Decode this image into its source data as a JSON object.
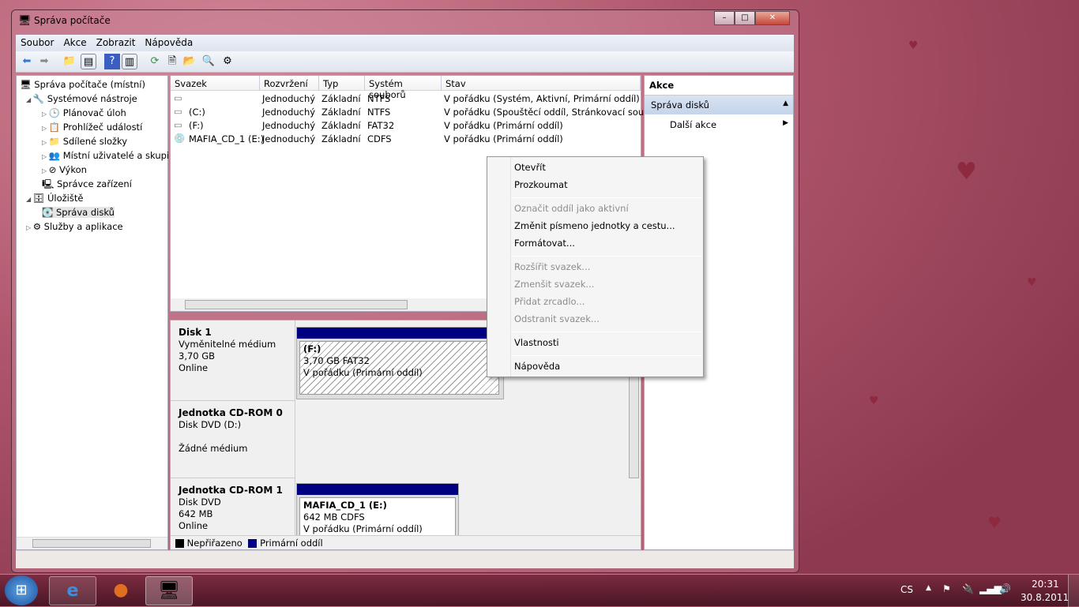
{
  "window": {
    "title": "Správa počítače",
    "buttons": [
      "–",
      "□",
      "✕"
    ]
  },
  "menu": [
    "Soubor",
    "Akce",
    "Zobrazit",
    "Nápověda"
  ],
  "tree": {
    "root": "Správa počítače (místní)",
    "items": [
      {
        "label": "Systémové nástroje",
        "level": 1
      },
      {
        "label": "Plánovač úloh",
        "level": 2
      },
      {
        "label": "Prohlížeč událostí",
        "level": 2
      },
      {
        "label": "Sdílené složky",
        "level": 2
      },
      {
        "label": "Místní uživatelé a skupiny",
        "level": 2
      },
      {
        "label": "Výkon",
        "level": 2
      },
      {
        "label": "Správce zařízení",
        "level": 2
      },
      {
        "label": "Úložiště",
        "level": 1
      },
      {
        "label": "Správa disků",
        "level": 2
      },
      {
        "label": "Služby a aplikace",
        "level": 1
      }
    ]
  },
  "volumes": {
    "columns": [
      "Svazek",
      "Rozvržení",
      "Typ",
      "Systém souborů",
      "Stav"
    ],
    "rows": [
      [
        "",
        "Jednoduchý",
        "Základní",
        "NTFS",
        "V pořádku (Systém, Aktivní, Primární oddíl)"
      ],
      [
        "(C:)",
        "Jednoduchý",
        "Základní",
        "NTFS",
        "V pořádku (Spouštěcí oddíl, Stránkovací soubo"
      ],
      [
        "(F:)",
        "Jednoduchý",
        "Základní",
        "FAT32",
        "V pořádku (Primární oddíl)"
      ],
      [
        "MAFIA_CD_1 (E:)",
        "Jednoduchý",
        "Základní",
        "CDFS",
        "V pořádku (Primární oddíl)"
      ]
    ]
  },
  "disks": [
    {
      "name": "Disk 1",
      "lines": [
        "Vyměnitelné médium",
        "3,70 GB",
        "Online"
      ],
      "partition": {
        "name": "(F:)",
        "size": "3,70 GB FAT32",
        "status": "V pořádku (Primární oddíl)"
      }
    },
    {
      "name": "Jednotka CD-ROM 0",
      "lines": [
        "Disk DVD (D:)",
        "",
        "Žádné médium"
      ]
    },
    {
      "name": "Jednotka CD-ROM 1",
      "lines": [
        "Disk DVD",
        "642 MB",
        "Online"
      ],
      "partition": {
        "name": "MAFIA_CD_1  (E:)",
        "size": "642 MB CDFS",
        "status": "V pořádku (Primární oddíl)"
      }
    }
  ],
  "legend": [
    "Nepřiřazeno",
    "Primární oddíl"
  ],
  "actions": {
    "header": "Akce",
    "section": "Správa disků",
    "more": "Další akce"
  },
  "context_menu": [
    {
      "label": "Otevřít",
      "enabled": true
    },
    {
      "label": "Prozkoumat",
      "enabled": true
    },
    {
      "label": "Označit oddíl jako aktivní",
      "enabled": false
    },
    {
      "label": "Změnit písmeno jednotky a cestu...",
      "enabled": true
    },
    {
      "label": "Formátovat...",
      "enabled": true
    },
    {
      "label": "Rozšířit svazek...",
      "enabled": false
    },
    {
      "label": "Zmenšit svazek...",
      "enabled": false
    },
    {
      "label": "Přidat zrcadlo...",
      "enabled": false
    },
    {
      "label": "Odstranit svazek...",
      "enabled": false
    },
    {
      "label": "Vlastnosti",
      "enabled": true
    },
    {
      "label": "Nápověda",
      "enabled": true
    }
  ],
  "tray": {
    "lang": "CS",
    "time": "20:31",
    "date": "30.8.2011"
  },
  "colors": {
    "primary_partition": "#000080",
    "unallocated": "#000000"
  }
}
